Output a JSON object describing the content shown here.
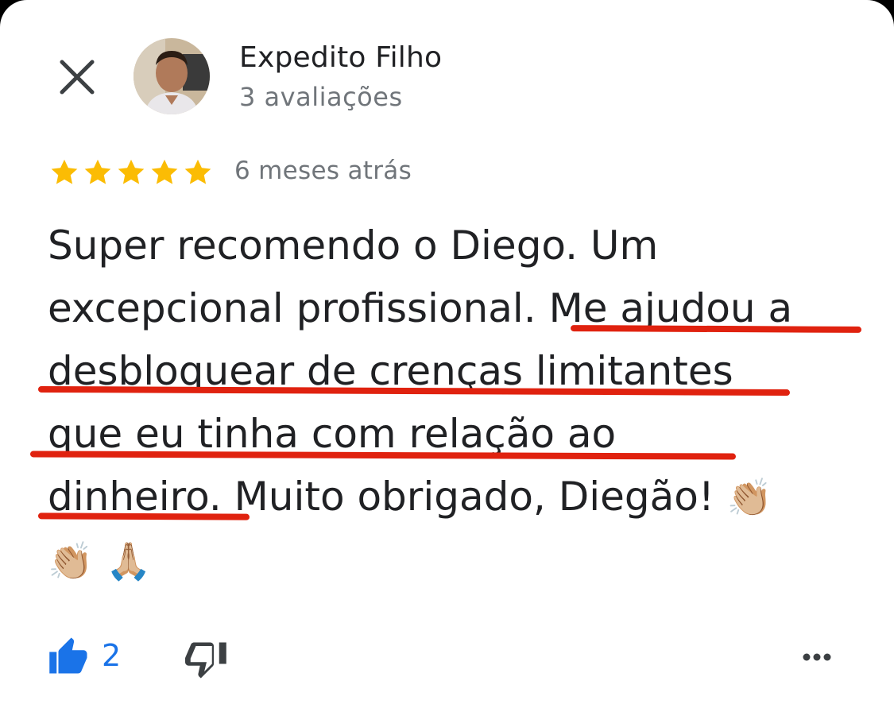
{
  "header": {
    "close_icon": "close-icon",
    "reviewer_name": "Expedito Filho",
    "review_count": "3 avaliações"
  },
  "rating": {
    "stars": 5,
    "max_stars": 5,
    "star_color": "#fbbc04",
    "time_ago": "6 meses atrás"
  },
  "review": {
    "line1": "Super recomendo o Diego. Um",
    "line2_plain": "excepcional profissional.",
    "line2_highlight": "Me ajudou a",
    "line3": "desbloquear de crenças limitantes",
    "line4": "que eu tinha com relação ao",
    "line5_highlight": "dinheiro.",
    "line5_plain": "Muito obrigado, Diegão!",
    "emoji_clap_1": "👏🏼",
    "emoji_clap_2": "👏🏼",
    "emoji_pray": "🙏🏼",
    "underline_color": "#e0220f"
  },
  "actions": {
    "like_count": "2",
    "like_color": "#1a73e8",
    "like_icon": "thumbs-up-icon",
    "dislike_icon": "thumbs-down-icon",
    "more_icon": "more-horizontal-icon"
  }
}
